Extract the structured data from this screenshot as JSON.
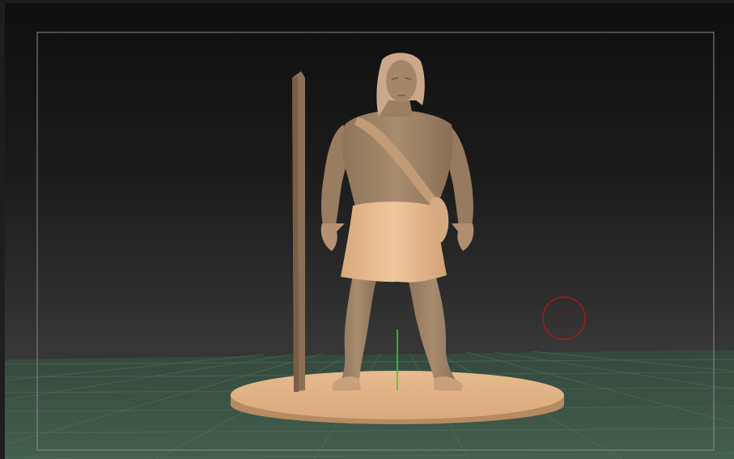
{
  "viewport": {
    "name": "3D viewport",
    "colors": {
      "background_top": "#0f0f0f",
      "background_bottom": "#3a3a3a",
      "floor": "#3c5446",
      "floor_grid": "#566e5e",
      "frame": "#8a8a8a",
      "model_skin": "#a88a6c",
      "model_cloth": "#d9b08a",
      "base_disc": "#dcae82",
      "y_axis": "#1fd21f",
      "brush_cursor": "#b01818"
    },
    "icons": {
      "brush_cursor": "circle-cursor-icon",
      "axis_gizmo": "y-axis-line"
    }
  }
}
